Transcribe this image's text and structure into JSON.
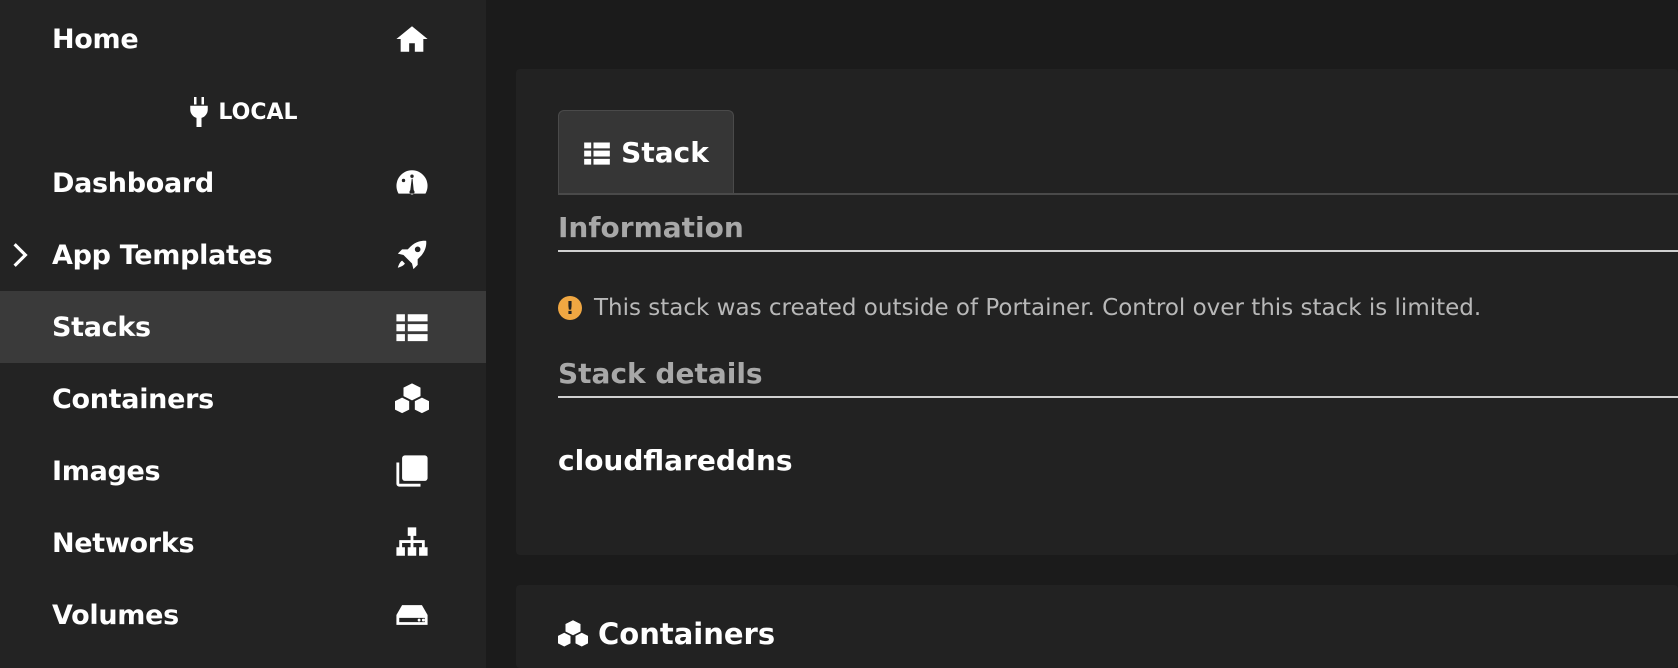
{
  "sidebar": {
    "home": {
      "label": "Home",
      "icon": "home-icon"
    },
    "environment": {
      "label": "LOCAL",
      "icon": "plug-icon"
    },
    "items": [
      {
        "label": "Dashboard",
        "icon": "tachometer-icon"
      },
      {
        "label": "App Templates",
        "icon": "rocket-icon",
        "expandable": true
      },
      {
        "label": "Stacks",
        "icon": "list-icon",
        "active": true
      },
      {
        "label": "Containers",
        "icon": "cubes-icon"
      },
      {
        "label": "Images",
        "icon": "clone-icon"
      },
      {
        "label": "Networks",
        "icon": "sitemap-icon"
      },
      {
        "label": "Volumes",
        "icon": "hdd-icon"
      }
    ]
  },
  "stack_panel": {
    "tab_label": "Stack",
    "information_title": "Information",
    "notice": "This stack was created outside of Portainer. Control over this stack is limited.",
    "details_title": "Stack details",
    "stack_name": "cloudflareddns"
  },
  "containers_panel": {
    "title": "Containers"
  },
  "colors": {
    "sidebar_bg": "#232323",
    "active_item_bg": "#3a3a3a",
    "panel_bg": "#222222",
    "warning": "#f0a742"
  }
}
